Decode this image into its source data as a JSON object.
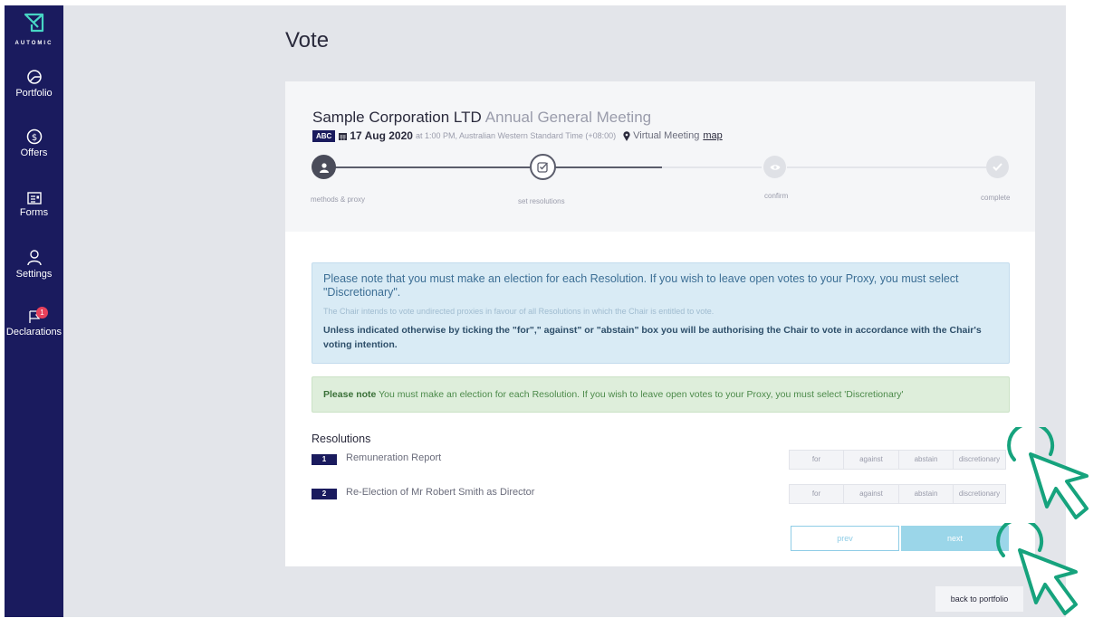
{
  "brand": {
    "logo_text": "AUTOMIC",
    "primary_color": "#1a1b5e",
    "accent_color": "#16a37d"
  },
  "sidebar": {
    "items": [
      {
        "label": "Portfolio",
        "icon": "pie-chart-icon"
      },
      {
        "label": "Offers",
        "icon": "dollar-circle-icon"
      },
      {
        "label": "Forms",
        "icon": "form-card-icon"
      },
      {
        "label": "Settings",
        "icon": "user-icon"
      },
      {
        "label": "Declarations",
        "icon": "flag-icon",
        "badge": "1"
      }
    ]
  },
  "page": {
    "title": "Vote"
  },
  "meeting": {
    "company": "Sample Corporation LTD",
    "type": "Annual General Meeting",
    "code": "ABC",
    "date": "17 Aug 2020",
    "time": "at 1:00 PM, Australian Western Standard Time (+08:00)",
    "venue": "Virtual Meeting",
    "map_label": "map"
  },
  "steps": [
    {
      "label": "methods & proxy",
      "state": "done",
      "icon": "user-icon"
    },
    {
      "label": "set resolutions",
      "state": "current",
      "icon": "checkbox-edit-icon"
    },
    {
      "label": "confirm",
      "state": "pending",
      "icon": "eye-icon"
    },
    {
      "label": "complete",
      "state": "pending",
      "icon": "check-icon"
    }
  ],
  "notice": {
    "main": "Please note that you must make an election for each Resolution. If you wish to leave open votes to your Proxy, you must select \"Discretionary\".",
    "sub": "The Chair intends to vote undirected proxies in favour of all Resolutions in which the Chair is entitled to vote.",
    "strong": "Unless indicated otherwise by ticking the \"for\",\" against\" or \"abstain\" box you will be authorising the Chair to vote in accordance with the Chair's voting intention."
  },
  "note": {
    "bold": "Please note",
    "text": " You must make an election for each Resolution. If you wish to leave open votes to your Proxy, you must select 'Discretionary'"
  },
  "resolutions": {
    "heading": "Resolutions",
    "options": [
      "for",
      "against",
      "abstain",
      "discretionary"
    ],
    "items": [
      {
        "num": "1",
        "label": "Remuneration Report"
      },
      {
        "num": "2",
        "label": "Re-Election of Mr Robert Smith as Director"
      }
    ]
  },
  "buttons": {
    "prev": "prev",
    "next": "next",
    "back": "back to portfolio"
  }
}
